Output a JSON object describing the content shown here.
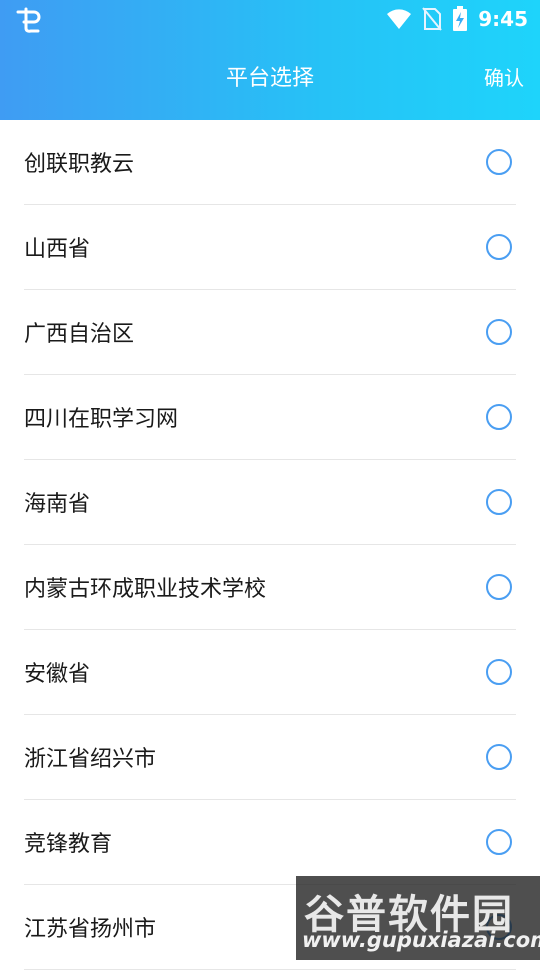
{
  "status_bar": {
    "time": "9:45",
    "app_icon": "app-logo-icon",
    "icons": [
      "wifi-icon",
      "no-sim-icon",
      "battery-charging-icon"
    ]
  },
  "nav": {
    "title": "平台选择",
    "confirm_label": "确认"
  },
  "platforms": [
    {
      "label": "创联职教云",
      "selected": false
    },
    {
      "label": "山西省",
      "selected": false
    },
    {
      "label": "广西自治区",
      "selected": false
    },
    {
      "label": "四川在职学习网",
      "selected": false
    },
    {
      "label": "海南省",
      "selected": false
    },
    {
      "label": "内蒙古环成职业技术学校",
      "selected": false
    },
    {
      "label": "安徽省",
      "selected": false
    },
    {
      "label": "浙江省绍兴市",
      "selected": false
    },
    {
      "label": "竞锋教育",
      "selected": false
    },
    {
      "label": "江苏省扬州市",
      "selected": false
    }
  ],
  "watermark": {
    "brand": "谷普软件园",
    "site": "www.gupuxiazai.com"
  },
  "colors": {
    "header_start": "#3f9cf3",
    "header_end": "#1ed4fb",
    "radio": "#4a9ef2"
  }
}
